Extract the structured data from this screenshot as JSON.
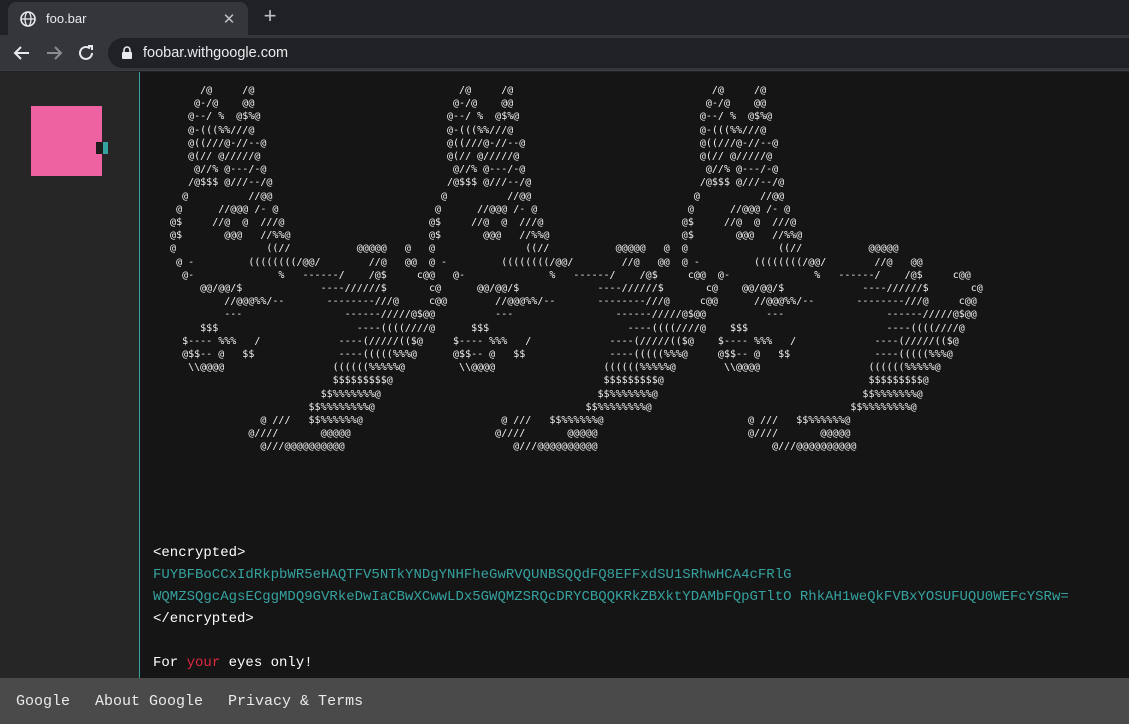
{
  "browser": {
    "tab_title": "foo.bar",
    "url": "foobar.withgoogle.com",
    "new_tab_label": "+",
    "close_label": "✕"
  },
  "page": {
    "accent_color": "#35a2a0",
    "logo_color": "#ef62a1",
    "ascii_art": "        /@     /@                                  /@     /@                                 /@     /@\n       @-/@    @@                                 @-/@    @@                                @-/@    @@\n      @--/ %  @$%@                               @--/ %  @$%@                              @--/ %  @$%@\n      @-(((%%///@                                @-(((%%///@                               @-(((%%///@\n      @((///@-//--@                              @((///@-//--@                             @((///@-//--@\n      @(// @/////@                               @(// @/////@                              @(// @/////@\n       @//% @---/-@                               @//% @---/-@                              @//% @---/-@\n      /@$$$ @///--/@                             /@$$$ @///--/@                            /@$$$ @///--/@\n     @          //@@                            @          //@@                           @          //@@\n    @      //@@@ /- @                          @      //@@@ /- @                         @      //@@@ /- @\n   @$     //@  @  ///@                        @$     //@  @  ///@                       @$     //@  @  ///@\n   @$       @@@   //%%@                       @$       @@@   //%%@                      @$       @@@   //%%@\n   @               ((//           @@@@@   @   @               ((//           @@@@@   @  @               ((//           @@@@@\n    @ -         ((((((((/@@/        //@   @@  @ -         ((((((((/@@/        //@   @@  @ -         ((((((((/@@/        //@   @@\n     @-              %   ------/    /@$     c@@   @-              %   ------/    /@$     c@@  @-              %   ------/    /@$     c@@\n        @@/@@/$             ----//////$       c@      @@/@@/$             ----//////$       c@    @@/@@/$             ----//////$       c@\n            //@@@%%/--       --------///@     c@@        //@@@%%/--       --------///@     c@@      //@@@%%/--       --------///@     c@@\n            ---                 ------/////@$@@          ---                 ------/////@$@@          ---                 ------/////@$@@\n        $$$                       ----((((////@      $$$                       ----((((////@    $$$                       ----((((////@\n     $---- %%%   /             ----(/////(($@     $---- %%%   /             ----(/////(($@    $---- %%%   /             ----(/////(($@\n     @$$-- @   $$              ----(((((%%%@      @$$-- @   $$              ----(((((%%%@     @$$-- @   $$              ----(((((%%%@\n      \\\\@@@@                  ((((((%%%%%@         \\\\@@@@                  ((((((%%%%%@        \\\\@@@@                  ((((((%%%%%@\n                              $$$$$$$$$@                                   $$$$$$$$$@                                  $$$$$$$$$@\n                            $$%%%%%%%@                                    $$%%%%%%%@                                  $$%%%%%%%@\n                          $$%%%%%%%%@                                   $$%%%%%%%%@                                 $$%%%%%%%%@\n                  @ ///   $$%%%%%%@                       @ ///   $$%%%%%%@                        @ ///   $$%%%%%%@\n                @////       @@@@@                        @////       @@@@@                         @////       @@@@@\n                  @///@@@@@@@@@@                            @///@@@@@@@@@@                             @///@@@@@@@@@@",
    "open_tag": "<encrypted>",
    "cipher_line_1": "FUYBFBoCCxIdRkpbWR5eHAQTFV5NTkYNDgYNHFheGwRVQUNBSQQdFQ8EFFxdSU1SRhwHCA4cFRlG",
    "cipher_line_2": "WQMZSQgcAgsECggMDQ9GVRkeDwIaCBwXCwwLDx5GWQMZSRQcDRYCBQQKRkZBXktYDAMbFQpGTltO RhkAH1weQkFVBxYOSUFUQU0WEFcYSRw=",
    "close_tag": "</encrypted>",
    "motto_before": "For ",
    "motto_accent": "your",
    "motto_after": " eyes only!"
  },
  "footer": {
    "links": [
      "Google",
      "About Google",
      "Privacy & Terms"
    ]
  }
}
